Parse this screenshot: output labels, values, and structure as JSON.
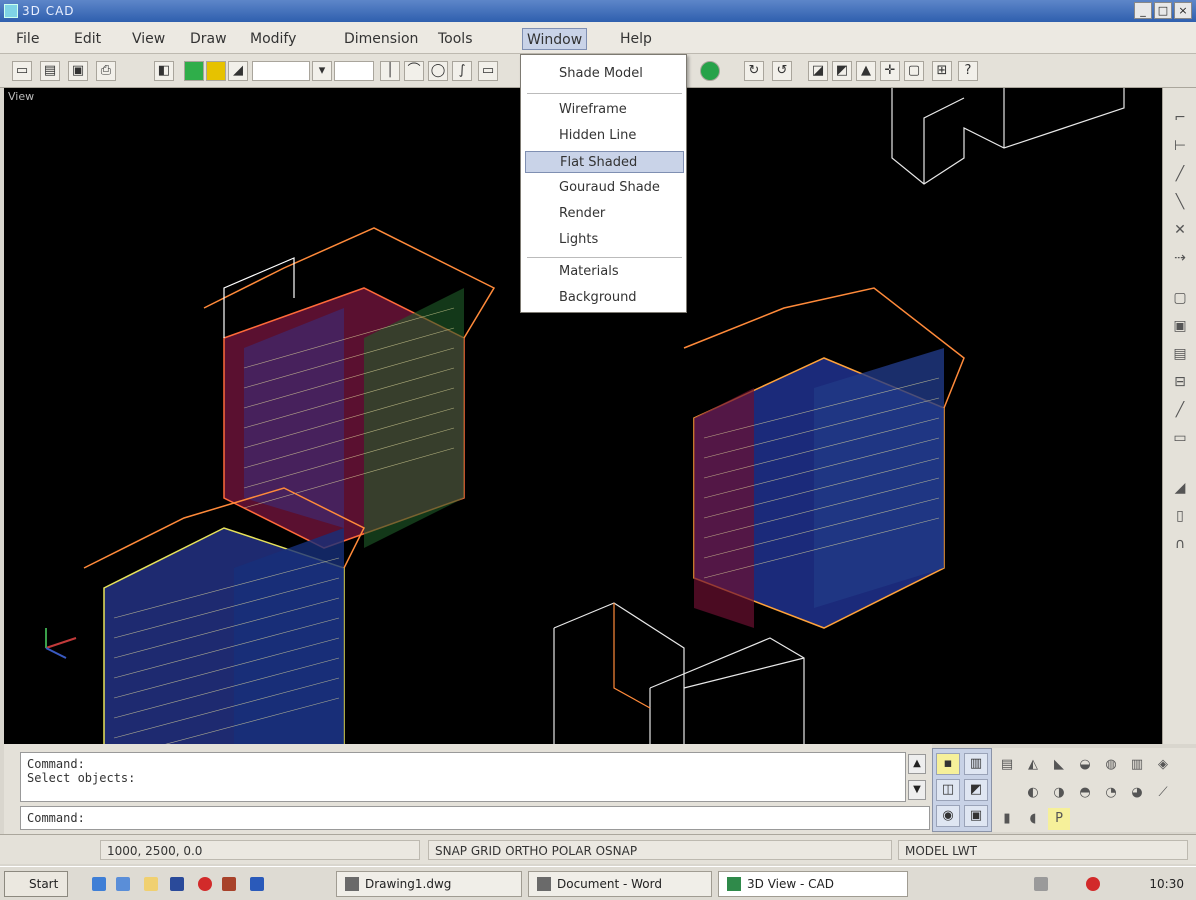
{
  "window": {
    "title": "3D CAD"
  },
  "menubar": {
    "items": [
      {
        "label": "File"
      },
      {
        "label": "Edit"
      },
      {
        "label": "View"
      },
      {
        "label": "Draw"
      },
      {
        "label": "Modify"
      },
      {
        "label": "Dimension"
      },
      {
        "label": "Tools"
      },
      {
        "label": "Window"
      },
      {
        "label": "Help"
      }
    ]
  },
  "dropdown": {
    "items": [
      {
        "label": "Shade Model"
      },
      {
        "label": "Wireframe"
      },
      {
        "label": "Hidden Line"
      },
      {
        "label": "Flat Shaded"
      },
      {
        "label": "Gouraud Shade"
      },
      {
        "label": "Render"
      },
      {
        "label": "Lights"
      },
      {
        "label": "Materials"
      },
      {
        "label": "Background"
      }
    ],
    "selected_index": 2
  },
  "viewport": {
    "label": "View"
  },
  "command": {
    "history": [
      "Command:",
      "Select objects:"
    ],
    "prompt": "Command:"
  },
  "statusbar": {
    "fields": [
      "1000, 2500, 0.0",
      "SNAP GRID ORTHO POLAR OSNAP",
      "MODEL LWT"
    ]
  },
  "taskbar": {
    "start_label": "Start",
    "tasks": [
      {
        "label": "Drawing1.dwg"
      },
      {
        "label": "Document - Word"
      },
      {
        "label": "3D View - CAD"
      }
    ],
    "clock": "10:30"
  },
  "colors": {
    "viewport_bg": "#000000",
    "menu_highlight": "#c9d3e8",
    "title_bar": "#2f5fae"
  }
}
